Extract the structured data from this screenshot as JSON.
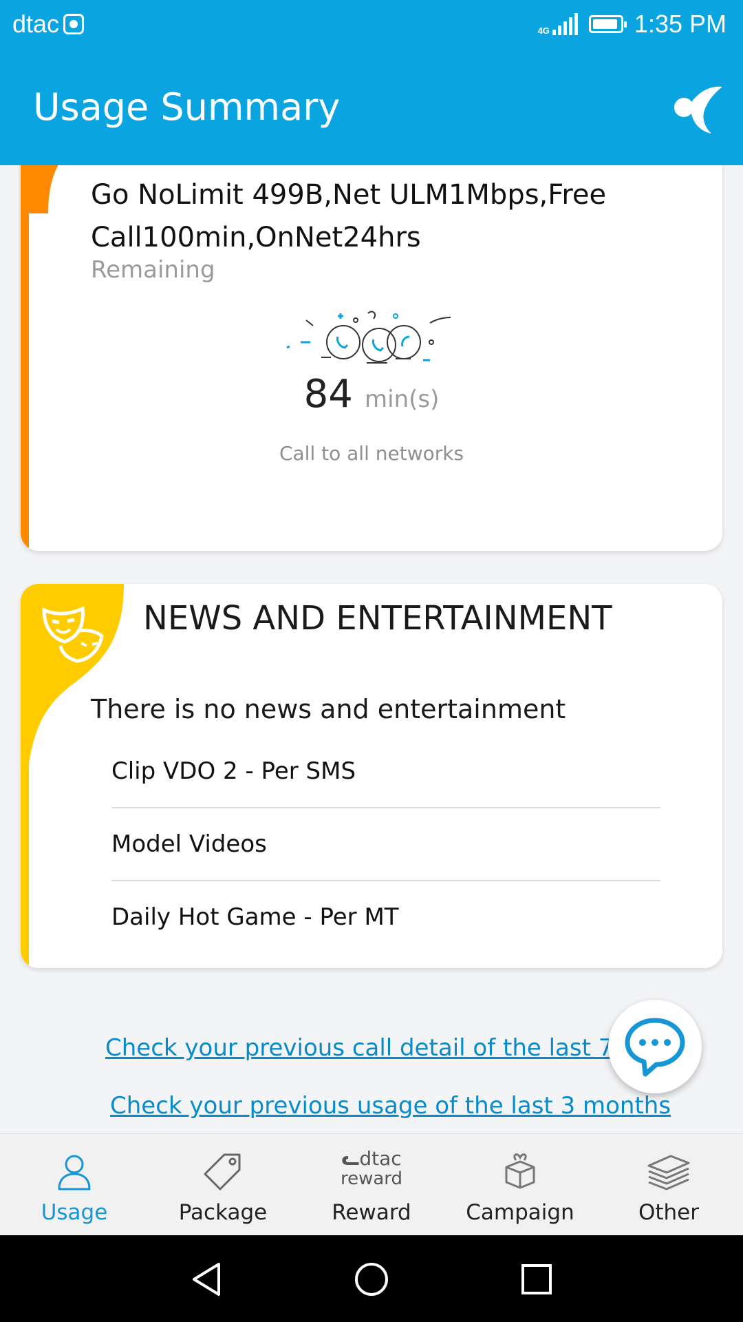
{
  "status_bar": {
    "carrier": "dtac",
    "network": "4G",
    "time": "1:35 PM"
  },
  "app_bar": {
    "title": "Usage Summary",
    "logo_icon": "dtac-logo-icon"
  },
  "package_card": {
    "accent_color": "#ff8a00",
    "name": "Go NoLimit 499B,Net ULM1Mbps,Free Call100min,OnNet24hrs",
    "remaining_label": "Remaining",
    "minutes_value": "84",
    "minutes_unit": "min(s)",
    "call_label": "Call to all networks"
  },
  "news_card": {
    "accent_color": "#ffcc00",
    "icon": "theater-mask-icon",
    "title": "NEWS AND ENTERTAINMENT",
    "empty_message": "There is no news and entertainment",
    "items": [
      "Clip VDO 2 - Per SMS",
      "Model Videos",
      "Daily Hot Game  - Per MT"
    ]
  },
  "links": {
    "call_detail": "Check your previous call detail of the last 7 days",
    "usage_history": "Check your previous usage of the last 3 months"
  },
  "chat_button": {
    "icon": "chat-bubble-icon"
  },
  "bottom_nav": {
    "active_color": "#1796d6",
    "items": [
      {
        "label": "Usage",
        "icon": "user-icon",
        "active": true
      },
      {
        "label": "Package",
        "icon": "tag-icon",
        "active": false
      },
      {
        "label": "Reward",
        "icon": "dtac-reward-icon",
        "active": false,
        "logo_text_1": "dtac",
        "logo_text_2": "reward"
      },
      {
        "label": "Campaign",
        "icon": "gift-icon",
        "active": false
      },
      {
        "label": "Other",
        "icon": "layers-icon",
        "active": false
      }
    ]
  },
  "system_nav": {
    "back": "back-icon",
    "home": "home-icon",
    "recents": "recents-icon"
  }
}
